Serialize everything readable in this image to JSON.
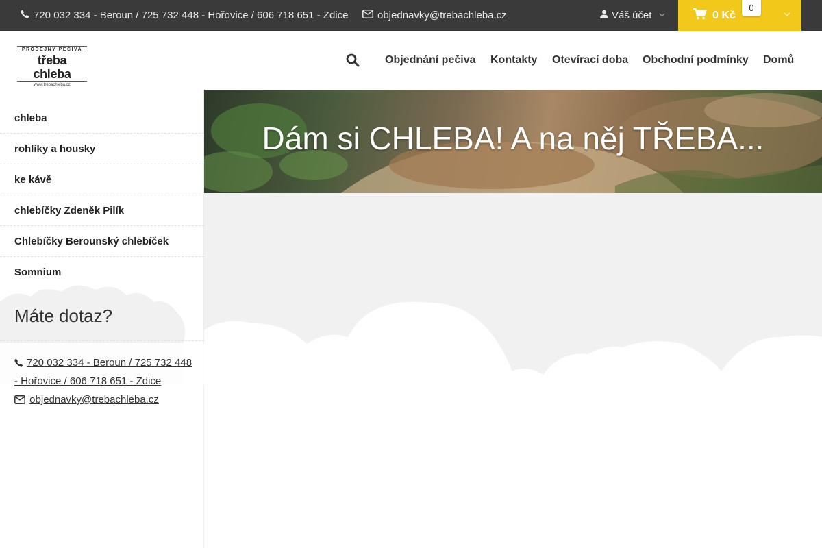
{
  "topbar": {
    "phone": "720 032 334 - Beroun / 725 732 448 - Hořovice / 606 718 651 - Zdice",
    "email": "objednavky@trebachleba.cz",
    "account_label": "Váš účet",
    "cart_total": "0 Kč",
    "cart_count": "0",
    "cart_color": "#f2c81b"
  },
  "header": {
    "logo": {
      "line1": "PRODEJNY PEČIVA",
      "line2": "třeba chleba",
      "line3": "www.trebachleba.cz"
    },
    "nav": [
      "Objednání pečiva",
      "Kontakty",
      "Otevírací doba",
      "Obchodní podmínky",
      "Domů"
    ]
  },
  "sidebar": {
    "categories": [
      "chleba",
      "rohlíky a housky",
      "ke kávě",
      "chlebíčky Zdeněk Pilík",
      "Chlebíčky Berounský chlebíček",
      "Somnium"
    ],
    "question_title": "Máte dotaz?",
    "phone": "720 032 334 - Beroun / 725 732 448 - Hořovice / 606 718 651 - Zdice",
    "email": "objednavky@trebachleba.cz"
  },
  "banner": {
    "title": "Dám si CHLEBA! A na něj TŘEBA..."
  }
}
